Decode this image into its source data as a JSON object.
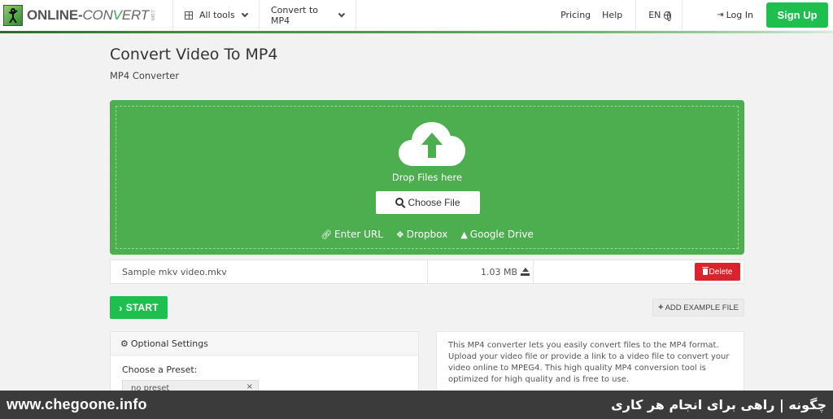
{
  "header": {
    "logo_main": "ONLINE-",
    "logo_convert_pre": "CON",
    "logo_convert_v": "V",
    "logo_convert_post": "ERT",
    "logo_com": ".com",
    "all_tools": "All tools",
    "convert_menu": "Convert to MP4",
    "pricing": "Pricing",
    "help": "Help",
    "language": "EN",
    "login": "Log In",
    "signup": "Sign Up"
  },
  "page": {
    "title": "Convert Video To MP4",
    "subtitle": "MP4 Converter"
  },
  "dropzone": {
    "drop_text": "Drop Files here",
    "choose_file": "Choose File",
    "sources": [
      {
        "icon": "link-icon",
        "label": "Enter URL"
      },
      {
        "icon": "dropbox-icon",
        "label": "Dropbox"
      },
      {
        "icon": "google-drive-icon",
        "label": "Google Drive"
      }
    ]
  },
  "file": {
    "name": "Sample mkv video.mkv",
    "size": "1.03 MB",
    "delete_label": "Delete"
  },
  "actions": {
    "start": "START",
    "add_example": "ADD EXAMPLE FILE"
  },
  "settings": {
    "title": "Optional Settings",
    "preset_label": "Choose a Preset:",
    "preset_value": "no preset"
  },
  "description": "This MP4 converter lets you easily convert files to the MP4 format. Upload your video file or provide a link to a video file to convert your video online to MPEG4. This high quality MP4 conversion tool is optimized for high quality and is free to use.",
  "watermark": {
    "left": "www.chegoone.info",
    "right": "چگونه | راهی برای انجام هر کاری"
  },
  "colors": {
    "brand_green": "#4cae4f",
    "signup_green": "#1fbf4f",
    "delete_red": "#d9232d"
  }
}
